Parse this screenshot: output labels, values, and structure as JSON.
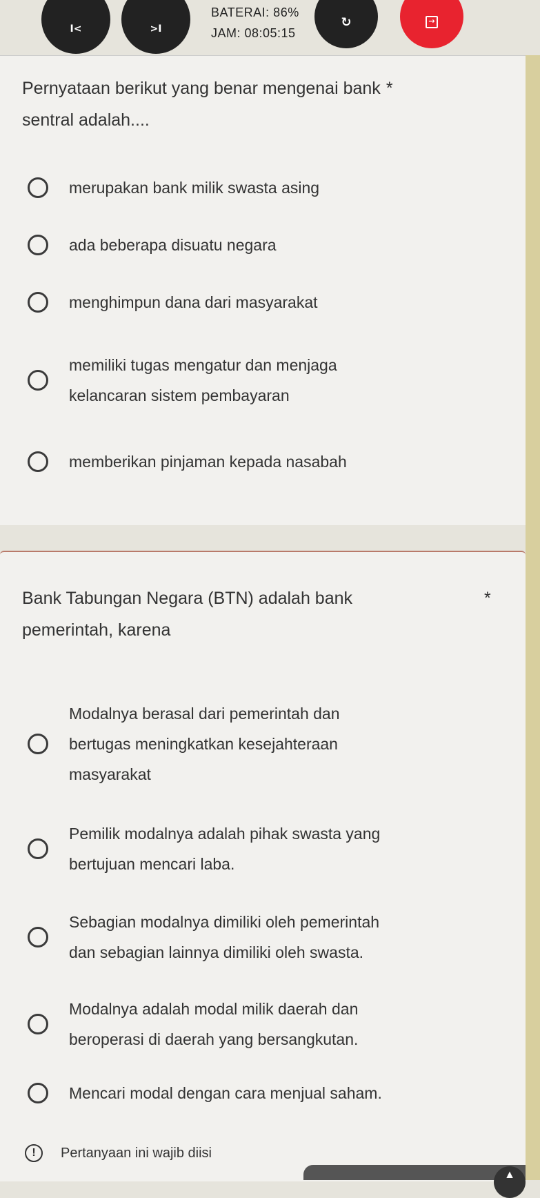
{
  "toolbar": {
    "prev_label": "I<",
    "next_label": ">I",
    "battery": "BATERAI: 86%",
    "clock": "JAM: 08:05:15",
    "refresh_icon": "refresh-icon",
    "exit_icon": "exit-icon",
    "exit_color": "#e8232f"
  },
  "questions": [
    {
      "text": "Pernyataan berikut yang benar mengenai bank * sentral adalah....",
      "line1": "Pernyataan berikut yang benar mengenai bank",
      "line2": "sentral adalah....",
      "required_mark": "*",
      "options": [
        "merupakan bank milik swasta asing",
        "ada beberapa disuatu negara",
        "menghimpun dana dari masyarakat",
        "memiliki tugas mengatur dan menjaga kelancaran sistem pembayaran",
        "memberikan pinjaman kepada nasabah"
      ],
      "option_lines": [
        [
          "merupakan bank milik swasta asing"
        ],
        [
          "ada beberapa disuatu negara"
        ],
        [
          "menghimpun dana dari masyarakat"
        ],
        [
          "memiliki tugas mengatur dan menjaga",
          "kelancaran sistem pembayaran"
        ],
        [
          "memberikan pinjaman kepada nasabah"
        ]
      ]
    },
    {
      "line1": "Bank Tabungan Negara (BTN) adalah bank",
      "line2": "pemerintah, karena",
      "required_mark": "*",
      "option_lines": [
        [
          "Modalnya berasal dari pemerintah dan",
          "bertugas meningkatkan kesejahteraan",
          "masyarakat"
        ],
        [
          "Pemilik modalnya adalah pihak swasta yang",
          "bertujuan mencari laba."
        ],
        [
          "Sebagian modalnya dimiliki oleh pemerintah",
          "dan sebagian lainnya dimiliki oleh swasta."
        ],
        [
          "Modalnya adalah modal milik daerah dan",
          "beroperasi di daerah yang bersangkutan."
        ],
        [
          "Mencari modal dengan cara menjual saham."
        ]
      ],
      "required_note": "Pertanyaan ini wajib diisi"
    }
  ]
}
